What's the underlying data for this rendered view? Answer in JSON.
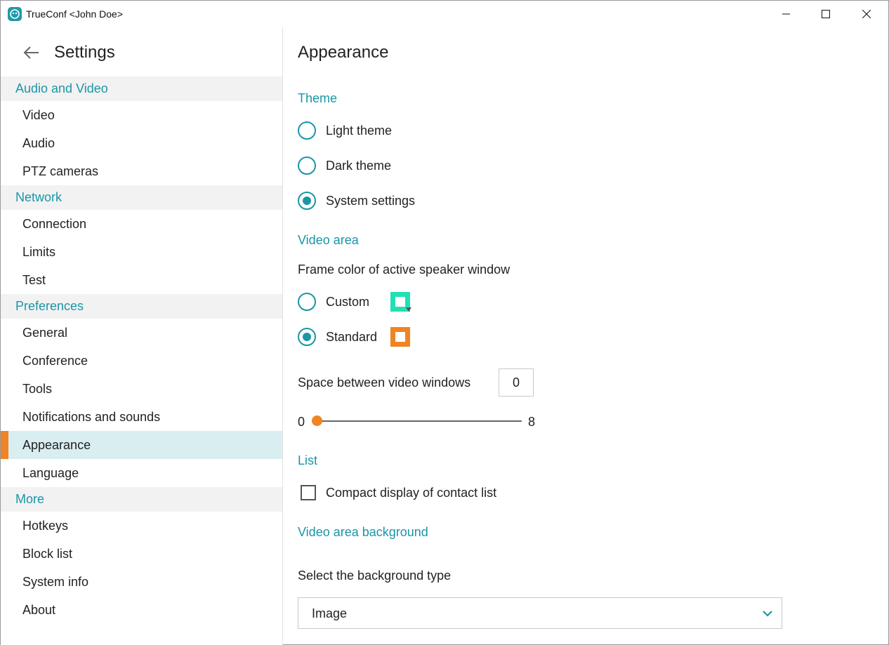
{
  "window": {
    "title": "TrueConf <John Doe>"
  },
  "sidebar": {
    "title": "Settings",
    "sections": [
      {
        "header": "Audio and Video",
        "items": [
          "Video",
          "Audio",
          "PTZ cameras"
        ]
      },
      {
        "header": "Network",
        "items": [
          "Connection",
          "Limits",
          "Test"
        ]
      },
      {
        "header": "Preferences",
        "items": [
          "General",
          "Conference",
          "Tools",
          "Notifications and sounds",
          "Appearance",
          "Language"
        ]
      },
      {
        "header": "More",
        "items": [
          "Hotkeys",
          "Block list",
          "System info",
          "About"
        ]
      }
    ],
    "active_item": "Appearance"
  },
  "main": {
    "title": "Appearance",
    "theme": {
      "heading": "Theme",
      "options": [
        "Light theme",
        "Dark theme",
        "System settings"
      ],
      "selected": "System settings"
    },
    "video_area": {
      "heading": "Video area",
      "frame_color_label": "Frame color of active speaker window",
      "custom_label": "Custom",
      "standard_label": "Standard",
      "selected": "Standard",
      "custom_color": "#22e0b4",
      "standard_color": "#f08424",
      "space_label": "Space between video windows",
      "space_value": "0",
      "slider_min": "0",
      "slider_max": "8",
      "slider_value": 0
    },
    "list": {
      "heading": "List",
      "compact_label": "Compact display of contact list",
      "compact_checked": false
    },
    "background": {
      "heading": "Video area background",
      "type_label": "Select the background type",
      "type_value": "Image"
    }
  },
  "colors": {
    "accent": "#1a96a6",
    "active_marker": "#f08424",
    "active_bg": "#d9eef1",
    "section_bg": "#f2f2f2"
  }
}
